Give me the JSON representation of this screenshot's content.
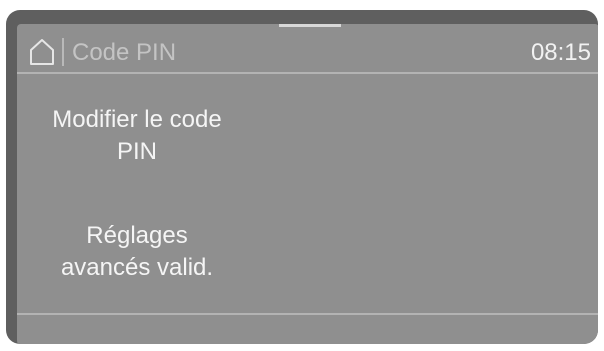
{
  "header": {
    "title": "Code PIN",
    "time": "08:15",
    "home_icon": "home-icon"
  },
  "menu": {
    "items": [
      {
        "line1": "Modifier le code",
        "line2": "PIN"
      },
      {
        "line1": "Réglages",
        "line2": "avancés valid."
      }
    ]
  },
  "colors": {
    "screen_background": "#8f8f8f",
    "bezel": "#5f5f5f",
    "text": "#f5f5f5",
    "title_text": "#c4c4c4"
  }
}
